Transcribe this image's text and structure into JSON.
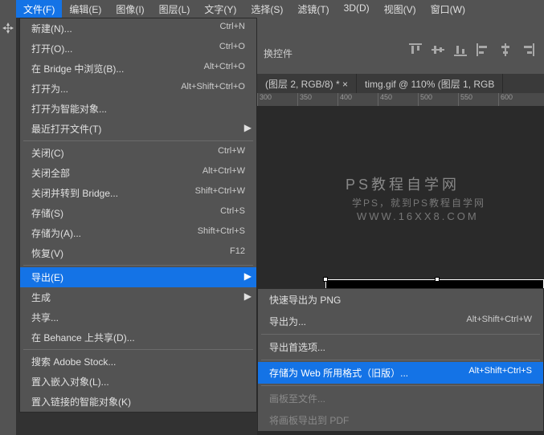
{
  "menubar": {
    "items": [
      "文件(F)",
      "编辑(E)",
      "图像(I)",
      "图层(L)",
      "文字(Y)",
      "选择(S)",
      "滤镜(T)",
      "3D(D)",
      "视图(V)",
      "窗口(W)"
    ]
  },
  "optionBar": {
    "swapWidget": "换控件"
  },
  "tabs": {
    "t0": "(图层 2, RGB/8) * ×",
    "t1": "timg.gif @ 110% (图层 1, RGB"
  },
  "ruler": [
    "0",
    "50",
    "3",
    "5",
    "0",
    "4",
    "0",
    "0",
    "4",
    "5",
    "0",
    "5",
    "0",
    "0",
    "5",
    "5",
    "0",
    "6",
    "0"
  ],
  "watermark": {
    "title": "PS教程自学网",
    "sub": "学PS，就到PS教程自学网",
    "url": "WWW.16XX8.COM"
  },
  "fileMenu": {
    "new_l": "新建(N)...",
    "new_s": "Ctrl+N",
    "open_l": "打开(O)...",
    "open_s": "Ctrl+O",
    "bridge_l": "在 Bridge 中浏览(B)...",
    "bridge_s": "Alt+Ctrl+O",
    "openAs_l": "打开为...",
    "openAs_s": "Alt+Shift+Ctrl+O",
    "smart_l": "打开为智能对象...",
    "recent_l": "最近打开文件(T)",
    "close_l": "关闭(C)",
    "close_s": "Ctrl+W",
    "closeAll_l": "关闭全部",
    "closeAll_s": "Alt+Ctrl+W",
    "closeBridge_l": "关闭并转到 Bridge...",
    "closeBridge_s": "Shift+Ctrl+W",
    "save_l": "存储(S)",
    "save_s": "Ctrl+S",
    "saveAs_l": "存储为(A)...",
    "saveAs_s": "Shift+Ctrl+S",
    "revert_l": "恢复(V)",
    "revert_s": "F12",
    "export_l": "导出(E)",
    "generate_l": "生成",
    "share_l": "共享...",
    "behance_l": "在 Behance 上共享(D)...",
    "stock_l": "搜索 Adobe Stock...",
    "placeEmbed_l": "置入嵌入对象(L)...",
    "placeLinked_l": "置入链接的智能对象(K)"
  },
  "exportSub": {
    "quick_l": "快速导出为 PNG",
    "exportAs_l": "导出为...",
    "exportAs_s": "Alt+Shift+Ctrl+W",
    "prefs_l": "导出首选项...",
    "web_l": "存储为 Web 所用格式（旧版）...",
    "web_s": "Alt+Shift+Ctrl+S",
    "artboardFile_l": "画板至文件...",
    "artboardPdf_l": "将画板导出到 PDF"
  }
}
